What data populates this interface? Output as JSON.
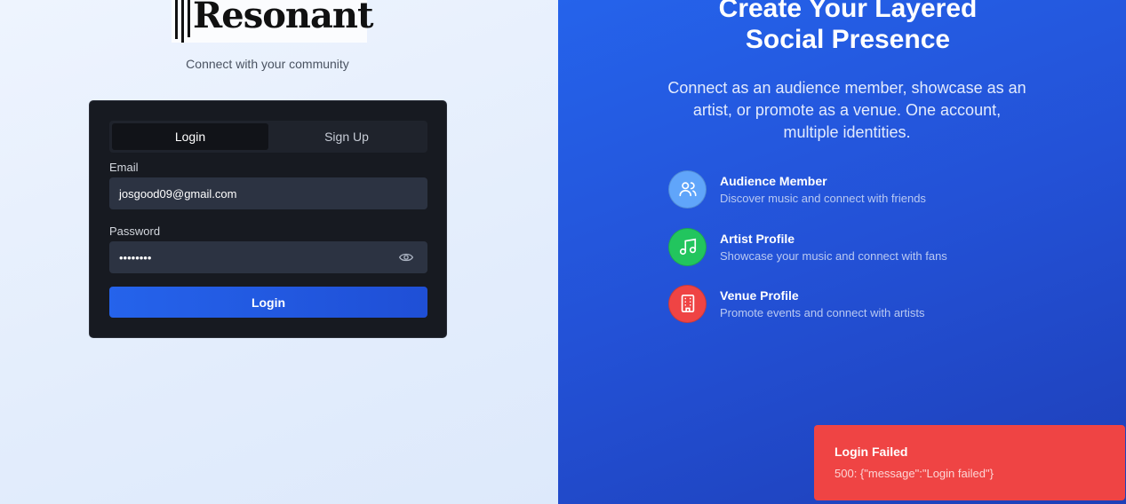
{
  "brand": {
    "name": "Resonant",
    "tagline": "Connect with your community"
  },
  "auth": {
    "tabs": [
      {
        "label": "Login",
        "active": true
      },
      {
        "label": "Sign Up",
        "active": false
      }
    ],
    "email": {
      "label": "Email",
      "value": "josgood09@gmail.com"
    },
    "password": {
      "label": "Password",
      "value": "••••••••"
    },
    "submit_label": "Login"
  },
  "hero": {
    "title_line1": "Create Your Layered",
    "title_line2": "Social Presence",
    "subtitle": "Connect as an audience member, showcase as an artist, or promote as a venue. One account, multiple identities.",
    "features": [
      {
        "title": "Audience Member",
        "desc": "Discover music and connect with friends",
        "icon": "users-icon",
        "color": "#60a5fa"
      },
      {
        "title": "Artist Profile",
        "desc": "Showcase your music and connect with fans",
        "icon": "music-note-icon",
        "color": "#22c55e"
      },
      {
        "title": "Venue Profile",
        "desc": "Promote events and connect with artists",
        "icon": "building-icon",
        "color": "#ef4444"
      }
    ]
  },
  "toast": {
    "title": "Login Failed",
    "message": "500: {\"message\":\"Login failed\"}",
    "color": "#ef4444"
  }
}
